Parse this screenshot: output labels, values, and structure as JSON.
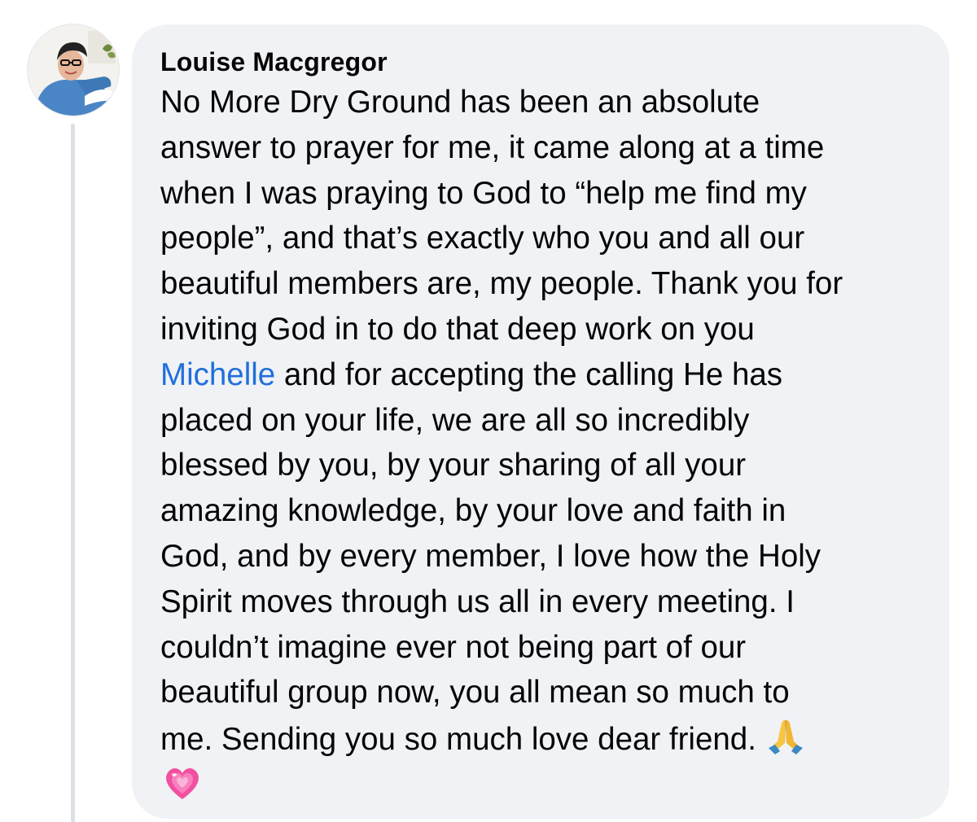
{
  "comment": {
    "author": "Louise Macgregor",
    "avatar_icon": "profile-photo",
    "lines": [
      "No More Dry Ground has been an absolute",
      "answer to prayer for me, it came along at a time",
      "when I was praying to God to “help me find my",
      "people”, and that’s exactly who you and all our",
      "beautiful members are, my people. Thank you for",
      "inviting God in to do that deep work on you"
    ],
    "mention": "Michelle",
    "mention_line_rest": " and for accepting the calling He has",
    "lines_after": [
      "placed on your life, we are all so incredibly",
      "blessed by you, by your sharing of all your",
      "amazing knowledge, by your love and faith in",
      "God, and by every member, I love how the Holy",
      "Spirit moves through us all in every meeting. I",
      "couldn’t imagine ever not being part of our",
      "beautiful group now, you all mean so much to"
    ],
    "last_line": "me. Sending you so much love dear friend.",
    "emojis": [
      "folded-hands-icon",
      "growing-heart-icon"
    ],
    "colors": {
      "bubble": "#f0f2f5",
      "mention": "#216fdb",
      "text": "#050505"
    }
  }
}
